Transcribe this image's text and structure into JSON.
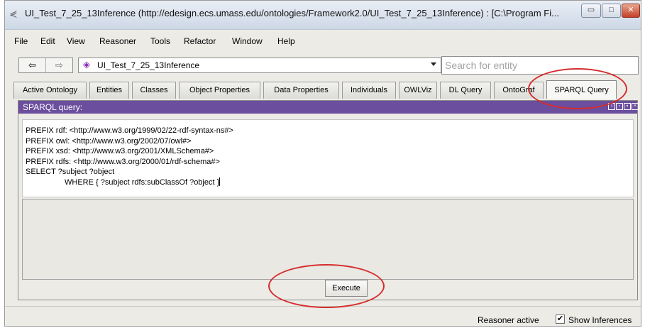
{
  "window": {
    "title": "UI_Test_7_25_13Inference (http://edesign.ecs.umass.edu/ontologies/Framework2.0/UI_Test_7_25_13Inference)  : [C:\\Program Fi...",
    "minimize_glyph": "▭",
    "maximize_glyph": "□",
    "close_glyph": "✕"
  },
  "menu": [
    "File",
    "Edit",
    "View",
    "Reasoner",
    "Tools",
    "Refactor",
    "Window",
    "Help"
  ],
  "nav": {
    "back_glyph": "⇦",
    "forward_glyph": "⇨",
    "ontology": "UI_Test_7_25_13Inference",
    "search_placeholder": "Search for entity"
  },
  "tabs": [
    "Active Ontology",
    "Entities",
    "Classes",
    "Object Properties",
    "Data Properties",
    "Individuals",
    "OWLViz",
    "DL Query",
    "OntoGraf",
    "SPARQL Query"
  ],
  "active_tab": "SPARQL Query",
  "sparql_view": {
    "title": "SPARQL query:",
    "query_lines": [
      "PREFIX rdf: <http://www.w3.org/1999/02/22-rdf-syntax-ns#>",
      "PREFIX owl: <http://www.w3.org/2002/07/owl#>",
      "PREFIX xsd: <http://www.w3.org/2001/XMLSchema#>",
      "PREFIX rdfs: <http://www.w3.org/2000/01/rdf-schema#>",
      "SELECT ?subject ?object",
      "                  WHERE { ?subject rdfs:subClassOf ?object }"
    ],
    "execute_label": "Execute"
  },
  "status": {
    "reasoner": "Reasoner active",
    "show_inferences_label": "Show Inferences",
    "show_inferences_checked": true
  },
  "colors": {
    "view_header": "#6b4e9d",
    "annotation": "#d62c2c"
  }
}
